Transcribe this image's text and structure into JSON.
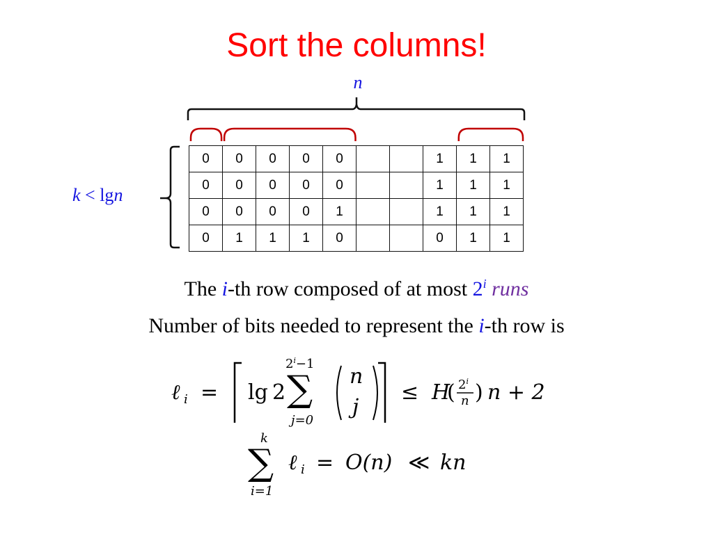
{
  "slide": {
    "title": "Sort the columns!",
    "n_label": "n",
    "k_label": {
      "k": "k",
      "lt": " < lg",
      "n": "n"
    },
    "grid": {
      "rows": [
        [
          "0",
          "0",
          "0",
          "0",
          "0",
          "",
          "",
          "1",
          "1",
          "1"
        ],
        [
          "0",
          "0",
          "0",
          "0",
          "0",
          "",
          "",
          "1",
          "1",
          "1"
        ],
        [
          "0",
          "0",
          "0",
          "0",
          "1",
          "",
          "",
          "1",
          "1",
          "1"
        ],
        [
          "0",
          "1",
          "1",
          "1",
          "0",
          "",
          "",
          "0",
          "1",
          "1"
        ]
      ],
      "run_groups": [
        [
          0,
          0
        ],
        [
          1,
          4
        ],
        [
          8,
          9
        ]
      ]
    },
    "line1": {
      "part1": "The ",
      "i": "i",
      "part2": "-th row composed of at most ",
      "two": "2",
      "sup": "i",
      "runs": " runs"
    },
    "line2": {
      "part1": "Number of bits needed to represent the ",
      "i": "i",
      "part2": "-th row is"
    },
    "equation1": {
      "lhs": "ℓ",
      "lhs_sub": "i",
      "eq": "=",
      "lg": "lg",
      "two": "2",
      "sum": "∑",
      "sum_upper": "2",
      "sum_upper_sup": "i",
      "sum_upper_rest": "−1",
      "sum_lower": "j=0",
      "binom_top": "n",
      "binom_bottom": "j",
      "leq": "≤",
      "H": "H",
      "frac_num": "2",
      "frac_num_sup": "i",
      "frac_den": "n",
      "tail": "n + 2"
    },
    "equation2": {
      "sum": "∑",
      "upper": "k",
      "lower": "i=1",
      "term": "ℓ",
      "term_sub": "i",
      "eq": "=",
      "O": "O(n)",
      "ll": "≪",
      "kn": "kn"
    },
    "colors": {
      "title": "#ff0000",
      "variable": "#1515e0",
      "runs": "#7030a0",
      "run_arcs": "#c00000"
    }
  }
}
